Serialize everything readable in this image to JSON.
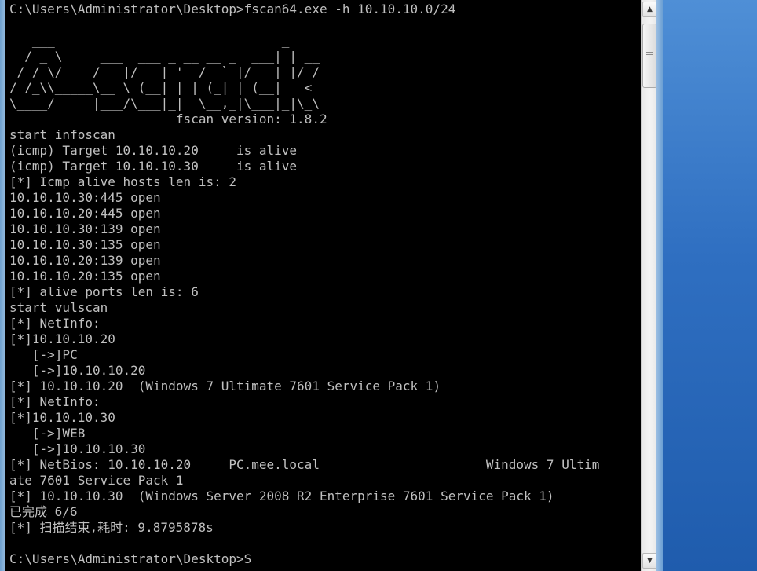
{
  "console": {
    "prompt_cmd": "C:\\Users\\Administrator\\Desktop>fscan64.exe -h 10.10.10.0/24",
    "banner": "   ___                              _\n  / _ \\     ___  ___ _ __ __ _  ___| | __\n / /_\\/____/ __|/ __| '__/ _` |/ __| |/ /\n/ /_\\\\_____\\__ \\ (__| | | (_| | (__|   <\n\\____/     |___/\\___|_|  \\__,_|\\___|_|\\_\\",
    "lines": [
      "                      fscan version: 1.8.2",
      "start infoscan",
      "(icmp) Target 10.10.10.20     is alive",
      "(icmp) Target 10.10.10.30     is alive",
      "[*] Icmp alive hosts len is: 2",
      "10.10.10.30:445 open",
      "10.10.10.20:445 open",
      "10.10.10.30:139 open",
      "10.10.10.30:135 open",
      "10.10.10.20:139 open",
      "10.10.10.20:135 open",
      "[*] alive ports len is: 6",
      "start vulscan",
      "[*] NetInfo:",
      "[*]10.10.10.20",
      "   [->]PC",
      "   [->]10.10.10.20",
      "[*] 10.10.10.20  (Windows 7 Ultimate 7601 Service Pack 1)",
      "[*] NetInfo:",
      "[*]10.10.10.30",
      "   [->]WEB",
      "   [->]10.10.10.30",
      "[*] NetBios: 10.10.10.20     PC.mee.local                      Windows 7 Ultim",
      "ate 7601 Service Pack 1",
      "[*] 10.10.10.30  (Windows Server 2008 R2 Enterprise 7601 Service Pack 1)",
      "已完成 6/6",
      "[*] 扫描结束,耗时: 9.8795878s"
    ],
    "prompt_end": "C:\\Users\\Administrator\\Desktop>S"
  },
  "scrollbar": {
    "up_icon": "▲",
    "down_icon": "▼"
  },
  "colors": {
    "console_bg": "#000000",
    "console_text": "#c0c0c0",
    "desktop": "#2f6fc1"
  }
}
